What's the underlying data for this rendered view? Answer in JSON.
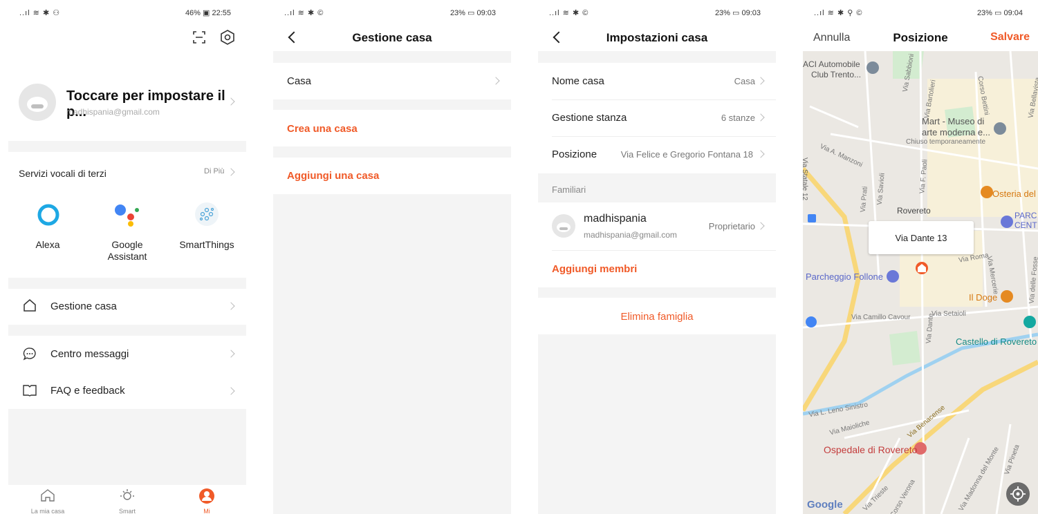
{
  "screen1": {
    "status": {
      "left": "..ıl ≋ ✱ ⚇",
      "right": "46% ▣ 22:55"
    },
    "profile": {
      "title": "Toccare per impostare il p...",
      "email": "madhispania@gmail.com"
    },
    "voice": {
      "title": "Servizi vocali di terzi",
      "more": "Di Più"
    },
    "services": [
      {
        "label": "Alexa",
        "icon": "alexa-icon"
      },
      {
        "label": "Google Assistant",
        "icon": "google-assistant-icon"
      },
      {
        "label": "SmartThings",
        "icon": "smartthings-icon"
      }
    ],
    "menu": {
      "home": "Gestione casa",
      "messages": "Centro messaggi",
      "faq": "FAQ e feedback"
    },
    "tabs": [
      {
        "label": "La mia casa"
      },
      {
        "label": "Smart"
      },
      {
        "label": "Mi"
      }
    ],
    "accent": "#f05a28"
  },
  "screen2": {
    "status": {
      "left": "..ıl ≋ ✱ ©",
      "right": "23% ▭ 09:03"
    },
    "title": "Gestione casa",
    "home_item": "Casa",
    "create": "Crea una casa",
    "add": "Aggiungi una casa"
  },
  "screen3": {
    "status": {
      "left": "..ıl ≋ ✱ ©",
      "right": "23% ▭ 09:03"
    },
    "title": "Impostazioni casa",
    "rows": {
      "name_label": "Nome casa",
      "name_value": "Casa",
      "rooms_label": "Gestione stanza",
      "rooms_value": "6 stanze",
      "pos_label": "Posizione",
      "pos_value": "Via Felice e Gregorio Fontana 18"
    },
    "family_header": "Familiari",
    "member": {
      "name": "madhispania",
      "email": "madhispania@gmail.com",
      "role": "Proprietario"
    },
    "add_members": "Aggiungi membri",
    "delete": "Elimina famiglia"
  },
  "screen4": {
    "status": {
      "left": "..ıl ≋ ✱ ⚲ ©",
      "right": "23% ▭ 09:04"
    },
    "cancel": "Annulla",
    "title": "Posizione",
    "save": "Salvare",
    "callout": "Via Dante 13",
    "map_labels": {
      "aci": "ACI Automobile",
      "aci2": "Club Trento...",
      "mart": "Mart - Museo di",
      "mart2": "arte moderna e...",
      "mart3": "Chiuso temporaneamente",
      "osteria": "Osteria del",
      "rovereto": "Rovereto",
      "parc": "PARC",
      "parc2": "CENT",
      "parcheggio": "Parcheggio Follone",
      "doge": "Il Doge",
      "castello": "Castello di Rovereto",
      "cavour": "Via Camillo Cavour",
      "setaioli": "Via Setaioli",
      "ospedale": "Ospedale di Rovereto",
      "google": "Google",
      "statale": "Via Statale 12",
      "benacense": "Via Benacense",
      "leno": "Via L. Leno Sinistro",
      "maioliche": "Via Maioliche",
      "manzoni": "Via A. Manzoni",
      "sabbioni": "Via Sabbioni",
      "bartolieri": "Via Bartolieri",
      "bettini": "Corso Bettini",
      "bellavista": "Via Bellavista",
      "paoli": "Via F. Paoli",
      "savioli": "Via Savioli",
      "prati": "Via Prati",
      "dante": "Via Dante",
      "roma": "Via Roma",
      "mercerie": "Via Mercerie",
      "fosse": "Via delle Fosse",
      "trieste": "Via Trieste",
      "verona": "Corso Verona",
      "madonna": "Via Madonna del Monte",
      "pineta": "Via Pineta"
    }
  }
}
